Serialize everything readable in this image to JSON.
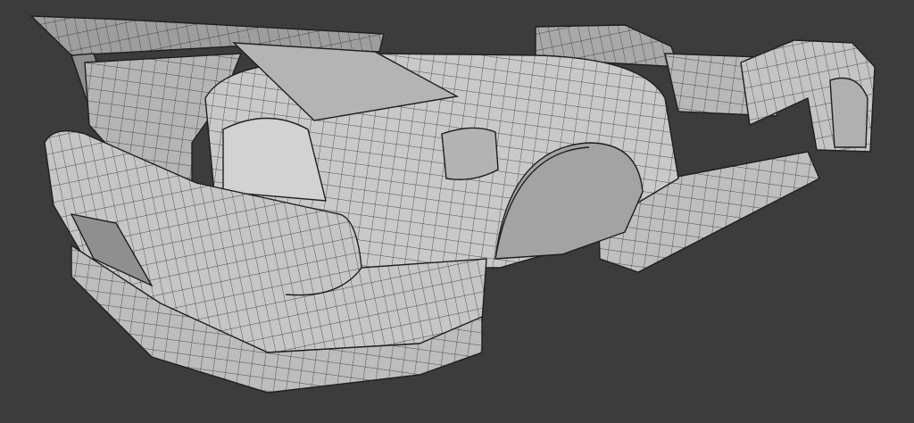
{
  "scene": {
    "subject": "car-body-kit-wireframe",
    "colors": {
      "background": "#3c3c3c",
      "surface": "#c9c9c9",
      "surface_shadow": "#a9a9a9",
      "surface_dark": "#8e8e8e",
      "wire": "#1e1e1e"
    }
  }
}
